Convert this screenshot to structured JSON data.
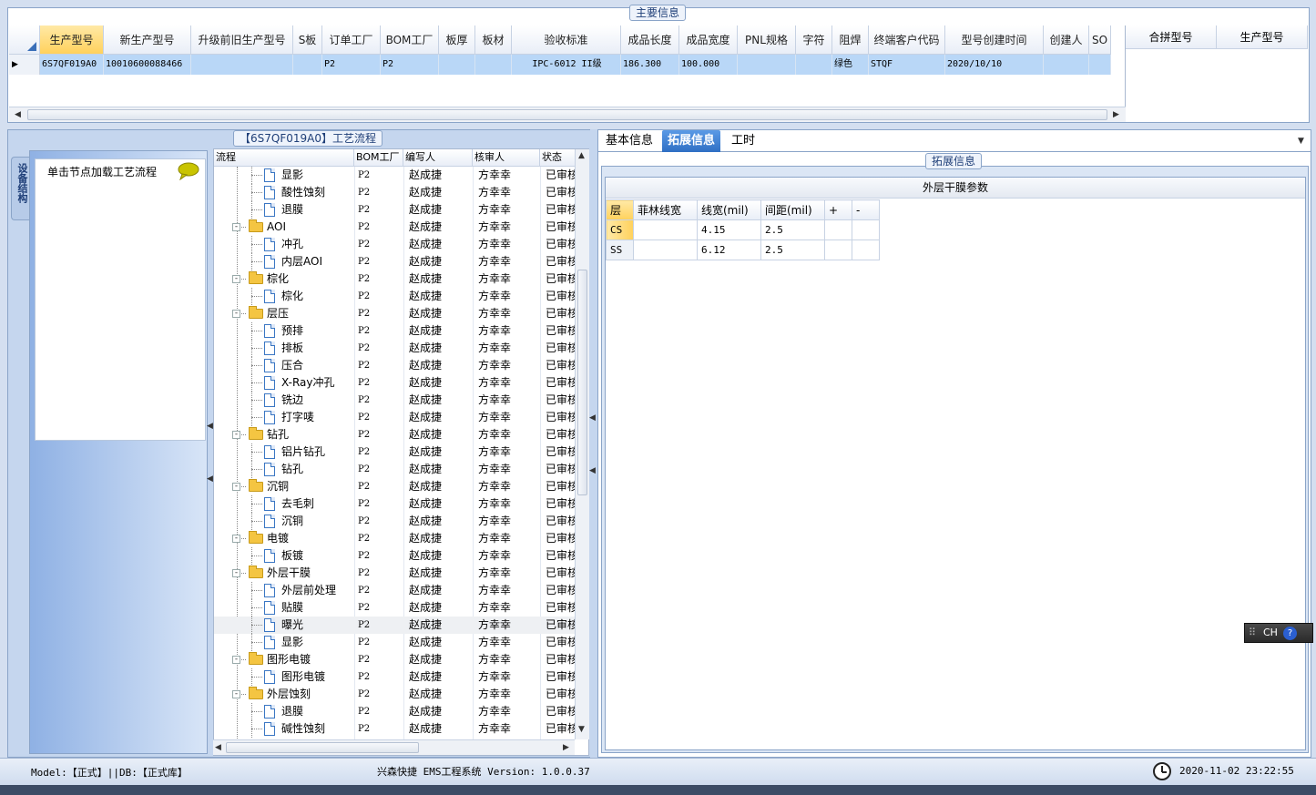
{
  "main": {
    "title": "主要信息",
    "columns": [
      "生产型号",
      "新生产型号",
      "升级前旧生产型号",
      "S板",
      "订单工厂",
      "BOM工厂",
      "板厚",
      "板材",
      "验收标准",
      "成品长度",
      "成品宽度",
      "PNL规格",
      "字符",
      "阻焊",
      "终端客户代码",
      "型号创建时间",
      "创建人",
      "SO"
    ],
    "row": [
      "6S7QF019A0",
      "10010600088466",
      "",
      "",
      "P2",
      "P2",
      "",
      "",
      "IPC-6012 II级",
      "186.300",
      "100.000",
      "",
      "",
      "绿色",
      "STQF",
      "2020/10/10",
      "",
      ""
    ],
    "right_columns": [
      "合拼型号",
      "生产型号"
    ]
  },
  "left": {
    "side_tab": "设备结构",
    "hint": "单击节点加载工艺流程"
  },
  "process": {
    "title": "【6S7QF019A0】工艺流程",
    "columns": [
      "流程",
      "BOM工厂",
      "编写人",
      "核审人",
      "状态"
    ],
    "rows": [
      {
        "name": "显影",
        "type": "leaf",
        "factory": "P2",
        "writer": "赵成捷",
        "reviewer": "方幸幸",
        "status": "已审核"
      },
      {
        "name": "酸性蚀刻",
        "type": "leaf",
        "factory": "P2",
        "writer": "赵成捷",
        "reviewer": "方幸幸",
        "status": "已审核"
      },
      {
        "name": "退膜",
        "type": "leaf",
        "factory": "P2",
        "writer": "赵成捷",
        "reviewer": "方幸幸",
        "status": "已审核"
      },
      {
        "name": "AOI",
        "type": "folder",
        "factory": "P2",
        "writer": "赵成捷",
        "reviewer": "方幸幸",
        "status": "已审核"
      },
      {
        "name": "冲孔",
        "type": "leaf",
        "factory": "P2",
        "writer": "赵成捷",
        "reviewer": "方幸幸",
        "status": "已审核"
      },
      {
        "name": "内层AOI",
        "type": "leaf",
        "factory": "P2",
        "writer": "赵成捷",
        "reviewer": "方幸幸",
        "status": "已审核"
      },
      {
        "name": "棕化",
        "type": "folder",
        "factory": "P2",
        "writer": "赵成捷",
        "reviewer": "方幸幸",
        "status": "已审核"
      },
      {
        "name": "棕化",
        "type": "leaf",
        "factory": "P2",
        "writer": "赵成捷",
        "reviewer": "方幸幸",
        "status": "已审核"
      },
      {
        "name": "层压",
        "type": "folder",
        "factory": "P2",
        "writer": "赵成捷",
        "reviewer": "方幸幸",
        "status": "已审核"
      },
      {
        "name": "预排",
        "type": "leaf",
        "factory": "P2",
        "writer": "赵成捷",
        "reviewer": "方幸幸",
        "status": "已审核"
      },
      {
        "name": "排板",
        "type": "leaf",
        "factory": "P2",
        "writer": "赵成捷",
        "reviewer": "方幸幸",
        "status": "已审核"
      },
      {
        "name": "压合",
        "type": "leaf",
        "factory": "P2",
        "writer": "赵成捷",
        "reviewer": "方幸幸",
        "status": "已审核"
      },
      {
        "name": "X-Ray冲孔",
        "type": "leaf",
        "factory": "P2",
        "writer": "赵成捷",
        "reviewer": "方幸幸",
        "status": "已审核"
      },
      {
        "name": "铣边",
        "type": "leaf",
        "factory": "P2",
        "writer": "赵成捷",
        "reviewer": "方幸幸",
        "status": "已审核"
      },
      {
        "name": "打字唛",
        "type": "leaf",
        "factory": "P2",
        "writer": "赵成捷",
        "reviewer": "方幸幸",
        "status": "已审核"
      },
      {
        "name": "钻孔",
        "type": "folder",
        "factory": "P2",
        "writer": "赵成捷",
        "reviewer": "方幸幸",
        "status": "已审核"
      },
      {
        "name": "铝片钻孔",
        "type": "leaf",
        "factory": "P2",
        "writer": "赵成捷",
        "reviewer": "方幸幸",
        "status": "已审核"
      },
      {
        "name": "钻孔",
        "type": "leaf",
        "factory": "P2",
        "writer": "赵成捷",
        "reviewer": "方幸幸",
        "status": "已审核"
      },
      {
        "name": "沉铜",
        "type": "folder",
        "factory": "P2",
        "writer": "赵成捷",
        "reviewer": "方幸幸",
        "status": "已审核"
      },
      {
        "name": "去毛刺",
        "type": "leaf",
        "factory": "P2",
        "writer": "赵成捷",
        "reviewer": "方幸幸",
        "status": "已审核"
      },
      {
        "name": "沉铜",
        "type": "leaf",
        "factory": "P2",
        "writer": "赵成捷",
        "reviewer": "方幸幸",
        "status": "已审核"
      },
      {
        "name": "电镀",
        "type": "folder",
        "factory": "P2",
        "writer": "赵成捷",
        "reviewer": "方幸幸",
        "status": "已审核"
      },
      {
        "name": "板镀",
        "type": "leaf",
        "factory": "P2",
        "writer": "赵成捷",
        "reviewer": "方幸幸",
        "status": "已审核"
      },
      {
        "name": "外层干膜",
        "type": "folder",
        "factory": "P2",
        "writer": "赵成捷",
        "reviewer": "方幸幸",
        "status": "已审核"
      },
      {
        "name": "外层前处理",
        "type": "leaf",
        "factory": "P2",
        "writer": "赵成捷",
        "reviewer": "方幸幸",
        "status": "已审核"
      },
      {
        "name": "贴膜",
        "type": "leaf",
        "factory": "P2",
        "writer": "赵成捷",
        "reviewer": "方幸幸",
        "status": "已审核"
      },
      {
        "name": "曝光",
        "type": "leaf",
        "factory": "P2",
        "writer": "赵成捷",
        "reviewer": "方幸幸",
        "status": "已审核",
        "selected": true
      },
      {
        "name": "显影",
        "type": "leaf",
        "factory": "P2",
        "writer": "赵成捷",
        "reviewer": "方幸幸",
        "status": "已审核"
      },
      {
        "name": "图形电镀",
        "type": "folder",
        "factory": "P2",
        "writer": "赵成捷",
        "reviewer": "方幸幸",
        "status": "已审核"
      },
      {
        "name": "图形电镀",
        "type": "leaf",
        "factory": "P2",
        "writer": "赵成捷",
        "reviewer": "方幸幸",
        "status": "已审核"
      },
      {
        "name": "外层蚀刻",
        "type": "folder",
        "factory": "P2",
        "writer": "赵成捷",
        "reviewer": "方幸幸",
        "status": "已审核"
      },
      {
        "name": "退膜",
        "type": "leaf",
        "factory": "P2",
        "writer": "赵成捷",
        "reviewer": "方幸幸",
        "status": "已审核"
      },
      {
        "name": "碱性蚀刻",
        "type": "leaf",
        "factory": "P2",
        "writer": "赵成捷",
        "reviewer": "方幸幸",
        "status": "已审核"
      }
    ]
  },
  "tabs": [
    {
      "label": "基本信息",
      "active": false
    },
    {
      "label": "拓展信息",
      "active": true
    },
    {
      "label": "工时",
      "active": false
    }
  ],
  "ext": {
    "group_title": "拓展信息",
    "table_title": "外层干膜参数",
    "columns": [
      "层",
      "菲林线宽",
      "线宽(mil)",
      "间距(mil)",
      "+",
      "-"
    ],
    "rows": [
      [
        "CS",
        "",
        "4.15",
        "2.5",
        "",
        ""
      ],
      [
        "SS",
        "",
        "6.12",
        "2.5",
        "",
        ""
      ]
    ]
  },
  "status": {
    "model": "Model:【正式】||DB:【正式库】",
    "app": "兴森快捷 EMS工程系统 Version: 1.0.0.37",
    "time": "2020-11-02 23:22:55"
  },
  "ime": {
    "label": "CH"
  },
  "colors": {
    "accent": "#2f6fc4",
    "selected_row": "#b9d7f7",
    "header_active": "#ffd15c"
  }
}
